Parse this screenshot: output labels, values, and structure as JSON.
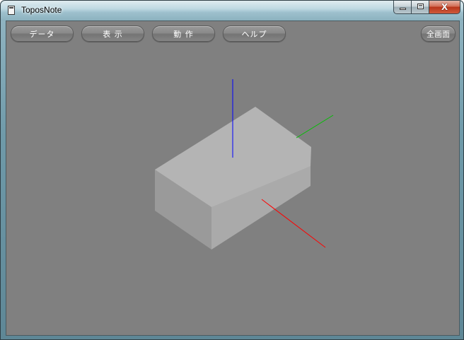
{
  "window": {
    "title": "ToposNote"
  },
  "caption": {
    "close_glyph": "X"
  },
  "toolbar": {
    "data_label": "データ",
    "view_label": "表 示",
    "action_label": "動 作",
    "help_label": "ヘルプ",
    "fullscreen_label": "全画面"
  },
  "scene": {
    "background": "#808080",
    "box_top_color": "#b4b4b4",
    "box_left_color": "#9a9a9a",
    "box_front_color": "#aaaaaa",
    "axis_x_color": "#ff0000",
    "axis_y_color": "#00c000",
    "axis_z_color": "#0000ff"
  }
}
